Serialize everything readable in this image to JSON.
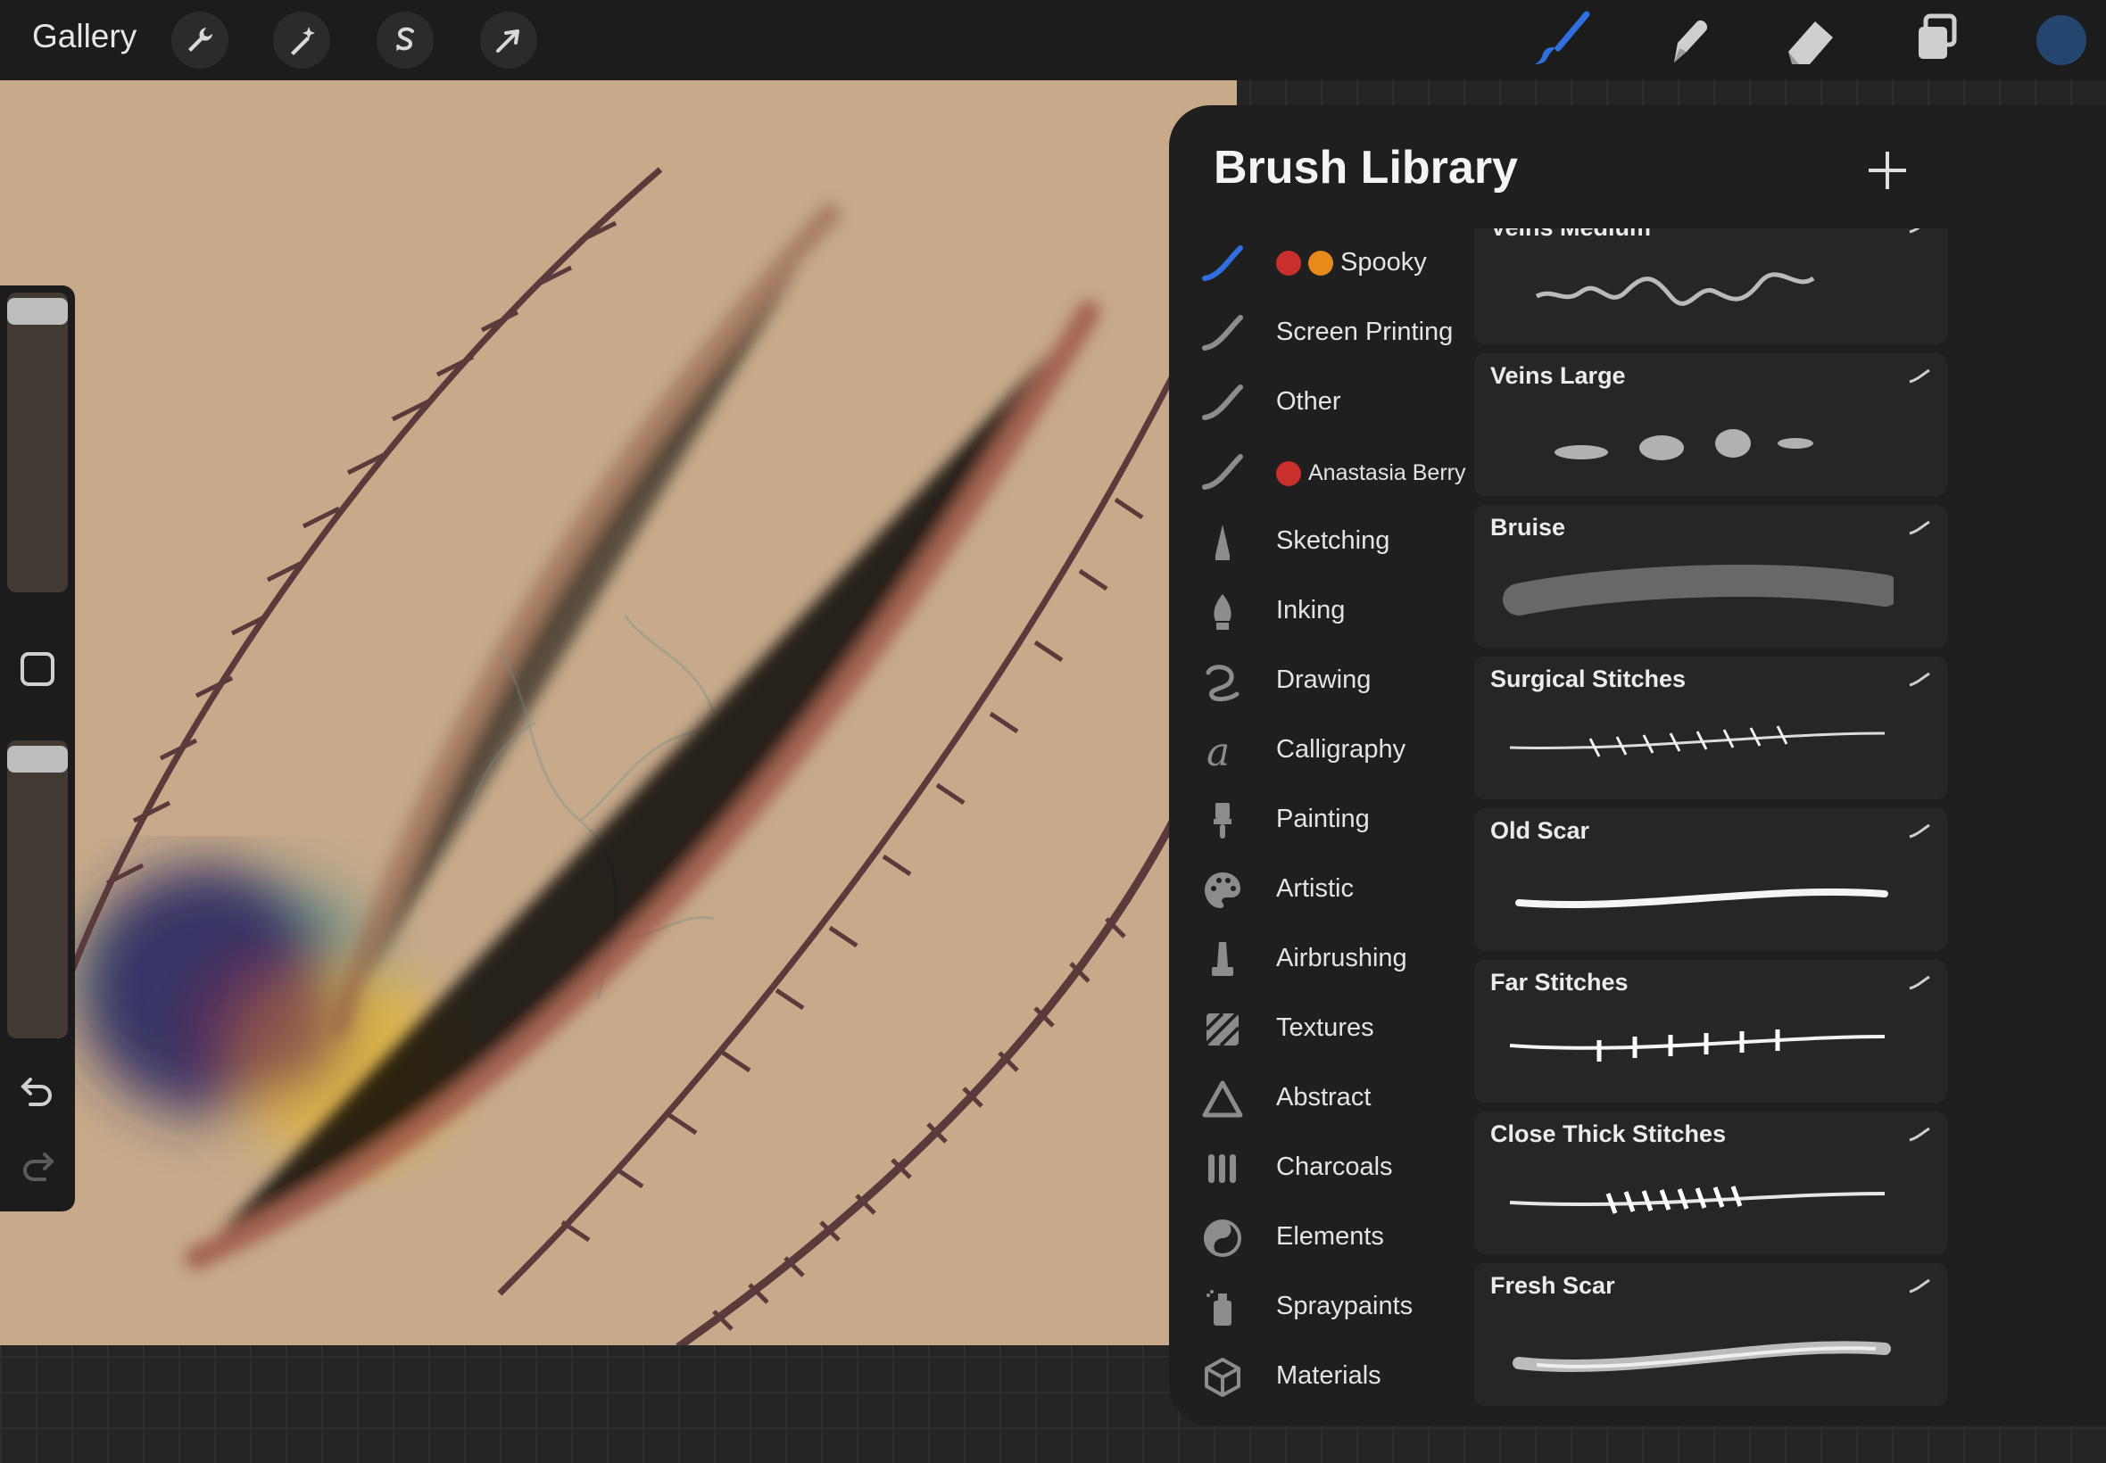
{
  "topbar": {
    "gallery_label": "Gallery",
    "left_tools": [
      "wrench-icon",
      "magic-wand-icon",
      "selection-icon",
      "transform-arrow-icon"
    ],
    "right_tools": [
      "brush-icon",
      "smudge-icon",
      "eraser-icon",
      "layers-icon"
    ],
    "active_tool": "brush-icon",
    "current_color": "#24466e"
  },
  "library": {
    "title": "Brush Library",
    "sets": [
      {
        "label": "Spooky",
        "prefix": "strawberry-pumpkin",
        "icon": "brush-stroke-icon",
        "selected": true
      },
      {
        "label": "Screen Printing",
        "icon": "brush-stroke-icon"
      },
      {
        "label": "Other",
        "icon": "brush-stroke-icon"
      },
      {
        "label": "Anastasia Berry",
        "prefix": "strawberry",
        "icon": "brush-stroke-icon"
      },
      {
        "label": "Sketching",
        "icon": "pencil-icon"
      },
      {
        "label": "Inking",
        "icon": "ink-pen-icon"
      },
      {
        "label": "Drawing",
        "icon": "squiggle-icon"
      },
      {
        "label": "Calligraphy",
        "icon": "calligraphy-icon"
      },
      {
        "label": "Painting",
        "icon": "paintbrush-icon"
      },
      {
        "label": "Artistic",
        "icon": "palette-icon"
      },
      {
        "label": "Airbrushing",
        "icon": "airbrush-icon"
      },
      {
        "label": "Textures",
        "icon": "texture-icon"
      },
      {
        "label": "Abstract",
        "icon": "triangle-icon"
      },
      {
        "label": "Charcoals",
        "icon": "charcoal-icon"
      },
      {
        "label": "Elements",
        "icon": "yin-yang-icon"
      },
      {
        "label": "Spraypaints",
        "icon": "spray-can-icon"
      },
      {
        "label": "Materials",
        "icon": "cube-icon"
      }
    ],
    "brushes": [
      {
        "name": "Veins Medium"
      },
      {
        "name": "Veins Large"
      },
      {
        "name": "Bruise"
      },
      {
        "name": "Surgical Stitches"
      },
      {
        "name": "Old Scar"
      },
      {
        "name": "Far Stitches"
      },
      {
        "name": "Close Thick Stitches"
      },
      {
        "name": "Fresh Scar"
      }
    ]
  },
  "colors": {
    "canvas": "#c6aa8a",
    "accent": "#2f6fe0",
    "panel": "#1f1f1f"
  }
}
